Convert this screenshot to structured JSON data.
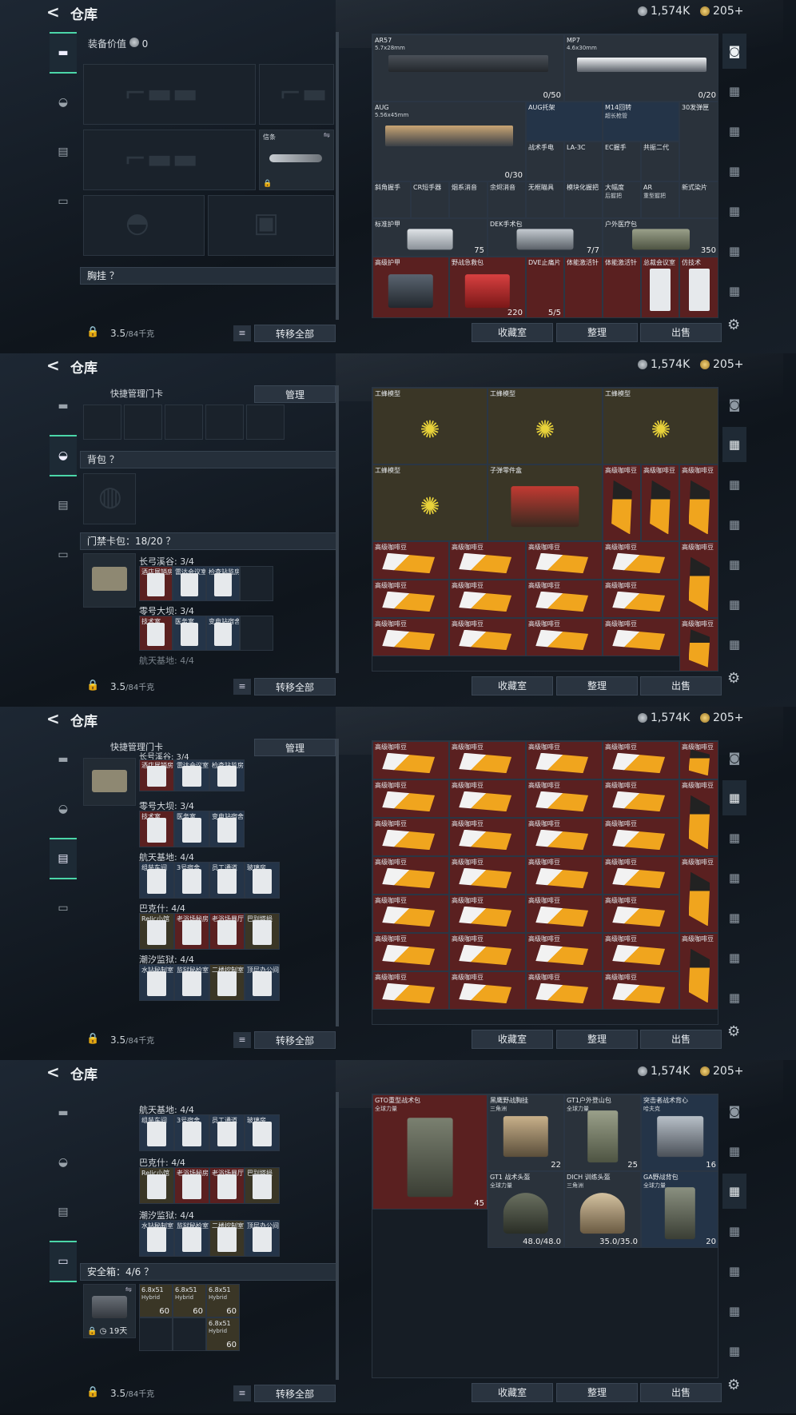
{
  "header": {
    "back": "<",
    "title": "仓库",
    "silver": "1,574K",
    "gold": "205+"
  },
  "footer": {
    "weight": "3.5",
    "weight_unit": "/84千克",
    "move_all": "转移全部",
    "list_icon": "≡"
  },
  "right_actions": {
    "collection": "收藏室",
    "sort": "整理",
    "sell": "出售"
  },
  "panel1": {
    "equip_value_label": "装备价值",
    "equip_value": "0",
    "melee_name": "信条",
    "chest_title": "胸挂 ？",
    "items": [
      {
        "name": "AR57",
        "sub": "5.7x28mm",
        "count": "0/50"
      },
      {
        "name": "MP7",
        "sub": "4.6x30mm",
        "count": "0/20"
      },
      {
        "name": "AUG",
        "sub": "5.56x45mm",
        "count": "0/30"
      },
      {
        "name": "AUG托架",
        "sub": ""
      },
      {
        "name": "M14回转",
        "sub": "超长枪管"
      },
      {
        "name": "30发弹匣",
        "sub": ""
      },
      {
        "name": "战术手电",
        "sub": ""
      },
      {
        "name": "LA-3C",
        "sub": ""
      },
      {
        "name": "EC握手",
        "sub": ""
      },
      {
        "name": "共振二代",
        "sub": ""
      },
      {
        "name": "斜角握手",
        "sub": ""
      },
      {
        "name": "CR短手器",
        "sub": ""
      },
      {
        "name": "烟系消音",
        "sub": ""
      },
      {
        "name": "余烬消音",
        "sub": ""
      },
      {
        "name": "无框瞄具",
        "sub": ""
      },
      {
        "name": "模块化握把",
        "sub": ""
      },
      {
        "name": "大幅度",
        "sub": "后握把"
      },
      {
        "name": "AR",
        "sub": "重型握把"
      },
      {
        "name": "新式染片",
        "sub": ""
      },
      {
        "name": "标准护甲",
        "sub": "",
        "count": "75"
      },
      {
        "name": "DEK手术包",
        "sub": "",
        "count": "7/7"
      },
      {
        "name": "户外医疗包",
        "sub": "",
        "count": "350"
      },
      {
        "name": "高级护甲",
        "sub": ""
      },
      {
        "name": "野战急救包",
        "sub": "",
        "count": "220"
      },
      {
        "name": "DVE止痛片",
        "sub": "",
        "count": "5/5"
      },
      {
        "name": "体能激活针",
        "sub": ""
      },
      {
        "name": "体能激活针",
        "sub": ""
      },
      {
        "name": "总裁会议室",
        "sub": ""
      },
      {
        "name": "仿技术",
        "sub": ""
      }
    ]
  },
  "panel2": {
    "quick_manage": "快捷管理门卡",
    "manage": "管理",
    "backpack_title": "背包 ？",
    "keycard_title": "门禁卡包：18/20 ？",
    "group1": "长弓溪谷: 3/4",
    "group2": "零号大坝: 3/4",
    "group3": "航天基地: 4/4",
    "cards_row1": [
      "酒店展销房",
      "雷达会议室",
      "检查站监房"
    ],
    "cards_row2": [
      "技术室",
      "医务室",
      "变电站宿舍"
    ],
    "bee": "工蜂模型",
    "parts": "子弹零件盒",
    "coffee": "高级咖啡豆"
  },
  "panel3": {
    "group1": "长号溪谷: 3/4",
    "group2": "零号大坝: 3/4",
    "group3": "航天基地: 4/4",
    "group4": "巴克什: 4/4",
    "group5": "潮汐监狱: 4/4",
    "cards_r1": [
      "酒店展销房",
      "雷达会议室",
      "检查站监房"
    ],
    "cards_r2": [
      "技术室",
      "医务室",
      "变电站宿舍"
    ],
    "cards_r3": [
      "组装车间",
      "3号宿舍",
      "员工通道",
      "玻璃房"
    ],
    "cards_r4": [
      "Relic小馆",
      "老浴场秘房",
      "老浴场暴厅",
      "巴别塔损"
    ],
    "cards_r5": [
      "水钻秘制室",
      "监狱秘检室",
      "二楼控制室",
      "顶层办公间"
    ],
    "coffee": "高级咖啡豆"
  },
  "panel4": {
    "group3": "航天基地: 4/4",
    "group4": "巴克什: 4/4",
    "group5": "潮汐监狱: 4/4",
    "safe_title": "安全箱：4/6 ？",
    "safe_timer": "19天",
    "ammo": "6.8x51",
    "ammo_sub": "Hybrid",
    "ammo_count": "60",
    "gear": [
      {
        "name": "GTO重型战术包",
        "sub": "全球力量",
        "count": "45"
      },
      {
        "name": "黑鹰野战胸挂",
        "sub": "三角洲",
        "count": "22"
      },
      {
        "name": "GT1户外登山包",
        "sub": "全球力量",
        "count": "25"
      },
      {
        "name": "突击者战术背心",
        "sub": "哈夫克",
        "count": "16"
      },
      {
        "name": "GT1 战术头盔",
        "sub": "全球力量",
        "count": "48.0/48.0"
      },
      {
        "name": "DICH 训练头盔",
        "sub": "三角洲",
        "count": "35.0/35.0"
      },
      {
        "name": "GA野战背包",
        "sub": "全球力量",
        "count": "20"
      }
    ]
  },
  "icons": [
    "back-icon",
    "silver-coin-icon",
    "gold-coin-icon",
    "gun-tab-icon",
    "helmet-tab-icon",
    "vest-tab-icon",
    "case-tab-icon",
    "settings-icon",
    "lock-icon",
    "swap-icon"
  ]
}
